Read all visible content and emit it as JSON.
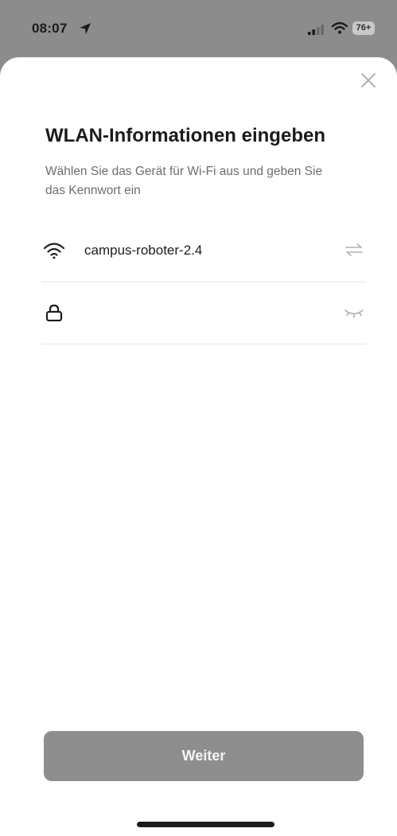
{
  "status_bar": {
    "time": "08:07",
    "battery": "76+"
  },
  "dialog": {
    "title": "WLAN-Informationen eingeben",
    "subtitle": "Wählen Sie das Gerät für Wi-Fi aus und geben Sie das Kennwort ein",
    "network": {
      "ssid": "campus-roboter-2.4"
    },
    "password": {
      "value": ""
    },
    "next_label": "Weiter"
  },
  "icons": {
    "location": "location-arrow-icon",
    "signal": "cellular-signal-icon",
    "wifi_status": "wifi-icon",
    "close": "close-icon",
    "network": "wifi-icon",
    "switch_network": "swap-arrows-icon",
    "lock": "lock-icon",
    "visibility": "eye-closed-icon"
  }
}
